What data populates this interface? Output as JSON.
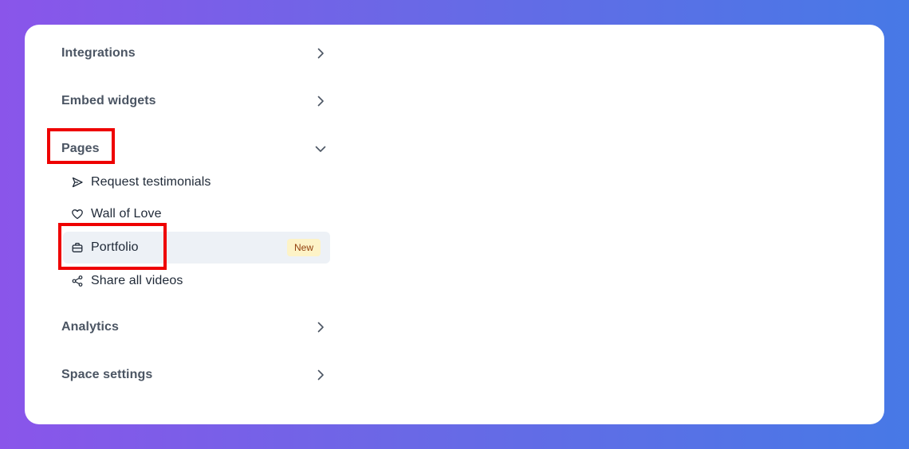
{
  "menu": {
    "integrations": {
      "label": "Integrations",
      "icon": "chevron-right-icon"
    },
    "embed_widgets": {
      "label": "Embed widgets",
      "icon": "chevron-right-icon"
    },
    "pages": {
      "label": "Pages",
      "icon": "chevron-down-icon",
      "expanded": true,
      "items": [
        {
          "label": "Request testimonials",
          "icon": "send-icon"
        },
        {
          "label": "Wall of Love",
          "icon": "heart-icon"
        },
        {
          "label": "Portfolio",
          "icon": "briefcase-icon",
          "badge": "New",
          "active": true
        },
        {
          "label": "Share all videos",
          "icon": "share-icon"
        }
      ]
    },
    "analytics": {
      "label": "Analytics",
      "icon": "chevron-right-icon"
    },
    "space_settings": {
      "label": "Space settings",
      "icon": "chevron-right-icon"
    }
  },
  "colors": {
    "highlight": "#ee0000",
    "active_bg": "#edf1f6",
    "badge_bg": "#fdf3c7",
    "badge_text": "#92400e",
    "gradient_start": "#8a55ea",
    "gradient_end": "#4779e6"
  }
}
